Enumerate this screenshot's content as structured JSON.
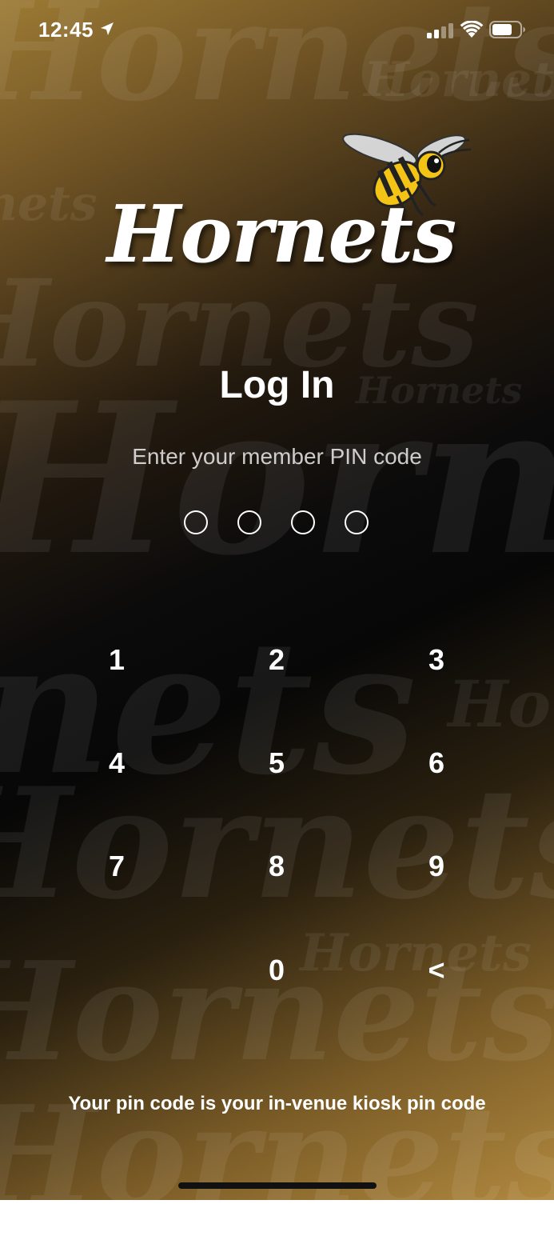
{
  "status_bar": {
    "time": "12:45",
    "icons": [
      "location-arrow-icon",
      "signal-icon",
      "wifi-icon",
      "battery-icon"
    ]
  },
  "brand": {
    "logo_text": "Hornets",
    "watermark_text": "Hornets",
    "mascot_icon": "bee-icon"
  },
  "login": {
    "title": "Log In",
    "subtitle": "Enter your member PIN code",
    "pin_length": 4,
    "pin_entered": 0
  },
  "keypad": {
    "keys": [
      "1",
      "2",
      "3",
      "4",
      "5",
      "6",
      "7",
      "8",
      "9",
      "",
      "0",
      "<"
    ]
  },
  "footer": {
    "note": "Your pin code is your in-venue kiosk pin code"
  },
  "colors": {
    "gold": "#b0883f",
    "dark": "#070707",
    "text": "#ffffff"
  }
}
